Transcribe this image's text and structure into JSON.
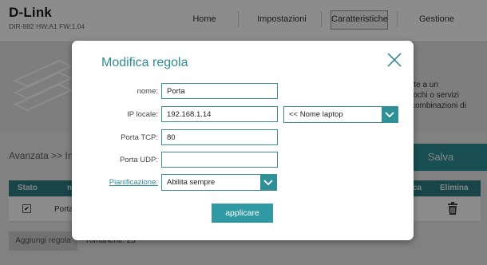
{
  "header": {
    "logo": "D-Link",
    "model": "DIR-882 HW:A1 FW:1.04",
    "nav": [
      "Home",
      "Impostazioni",
      "Caratteristiche",
      "Gestione"
    ],
    "active_nav": "Caratteristiche"
  },
  "background": {
    "hero_lines": [
      "rte a un",
      "iochi o servizi",
      "combinazioni di"
    ],
    "breadcrumb": "Avanzata >> In",
    "save_label": "Salva",
    "table": {
      "col_state": "Stato",
      "col_n": "n",
      "col_ca": "ca",
      "col_delete": "Elimina",
      "row_name": "Porta"
    },
    "add_rule_label": "Aggiungi regola",
    "remaining": "Rimanenti: 23"
  },
  "modal": {
    "title": "Modifica regola",
    "fields": {
      "name_label": "nome:",
      "name_value": "Porta",
      "ip_label": "IP locale:",
      "ip_value": "192.168.1.14",
      "device_select": "<< Nome laptop",
      "tcp_label": "Porta TCP:",
      "tcp_value": "80",
      "udp_label": "Porta UDP:",
      "udp_value": "",
      "schedule_label": "Pianificazione:",
      "schedule_value": "Abilita sempre"
    },
    "apply_label": "applicare"
  },
  "colors": {
    "accent": "#2e8c94",
    "button": "#2f9aa3"
  }
}
